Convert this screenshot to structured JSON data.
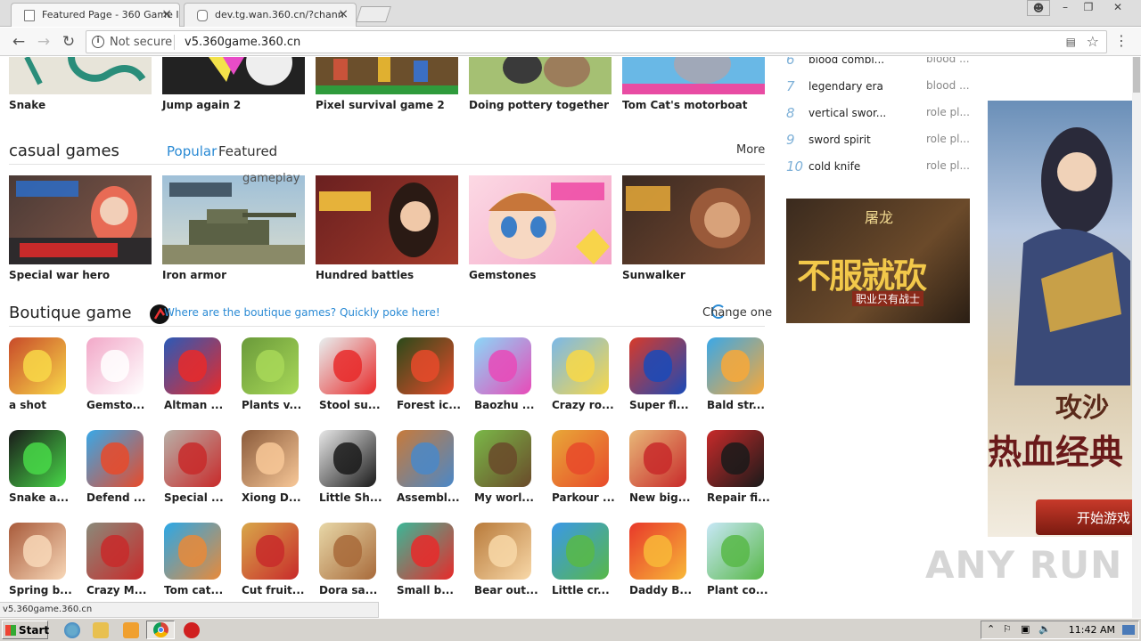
{
  "browser": {
    "tabs": [
      {
        "title": "Featured Page - 360 Game I",
        "active": true
      },
      {
        "title": "dev.tg.wan.360.cn/?chann",
        "active": false
      }
    ],
    "security_label": "Not secure",
    "url": "v5.360game.360.cn",
    "status_url": "v5.360game.360.cn"
  },
  "top_row": [
    {
      "title": "Snake"
    },
    {
      "title": "Jump again 2"
    },
    {
      "title": "Pixel survival game 2"
    },
    {
      "title": "Doing pottery together"
    },
    {
      "title": "Tom Cat's motorboat"
    }
  ],
  "casual": {
    "title": "casual games",
    "tabs": [
      "Popular",
      "Featured"
    ],
    "more": "More",
    "overlay_text": "gameplay",
    "games": [
      {
        "title": "Special war hero"
      },
      {
        "title": "Iron armor"
      },
      {
        "title": "Hundred battles"
      },
      {
        "title": "Gemstones"
      },
      {
        "title": "Sunwalker"
      }
    ]
  },
  "boutique": {
    "title": "Boutique game",
    "link": "Where are the boutique games? Quickly poke here!",
    "change": "Change one",
    "rows": [
      [
        "a shot",
        "Gemsto...",
        "Altman ...",
        "Plants v...",
        "Stool su...",
        "Forest ic...",
        "Baozhu ...",
        "Crazy ro...",
        "Super fl...",
        "Bald str..."
      ],
      [
        "Snake a...",
        "Defend ...",
        "Special ...",
        "Xiong D...",
        "Little Sh...",
        "Assembl...",
        "My worl...",
        "Parkour ...",
        "New big...",
        "Repair fi..."
      ],
      [
        "Spring b...",
        "Crazy M...",
        "Tom cat...",
        "Cut fruit...",
        "Dora sa...",
        "Small b...",
        "Bear out...",
        "Little cr...",
        "Daddy B...",
        "Plant co..."
      ]
    ]
  },
  "ranking": [
    {
      "num": "6",
      "name": "blood combi...",
      "type": "blood ..."
    },
    {
      "num": "7",
      "name": "legendary era",
      "type": "blood ..."
    },
    {
      "num": "8",
      "name": "vertical swor...",
      "type": "role pl..."
    },
    {
      "num": "9",
      "name": "sword spirit",
      "type": "role pl..."
    },
    {
      "num": "10",
      "name": "cold knife",
      "type": "role pl..."
    }
  ],
  "ads": {
    "banner_text": "不服就砍",
    "banner_sub": "职业只有战士",
    "banner_top": "屠龙",
    "side_title": "热血经典",
    "side_sub": "攻沙",
    "side_button": "开始游戏"
  },
  "taskbar": {
    "start": "Start",
    "clock": "11:42 AM"
  },
  "watermark": "ANY RUN"
}
